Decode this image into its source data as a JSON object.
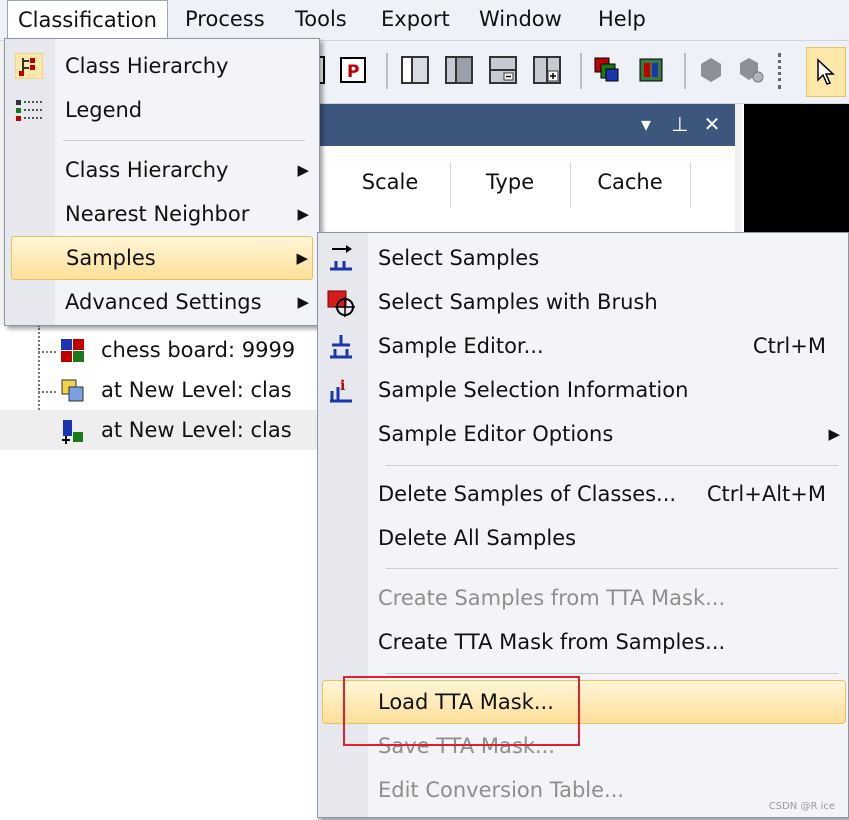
{
  "menubar": {
    "items": [
      "Classification",
      "Process",
      "Tools",
      "Export",
      "Window",
      "Help"
    ],
    "active": "Classification"
  },
  "panel": {
    "columns": [
      "Scale",
      "Type",
      "Cache"
    ]
  },
  "tree": {
    "rows": [
      {
        "text": "chess board: 9999"
      },
      {
        "text": "at  New Level: clas"
      },
      {
        "text": "at  New Level: clas"
      }
    ]
  },
  "classification_menu": {
    "items": [
      {
        "label": "Class Hierarchy",
        "icon": "class-hierarchy-icon",
        "submenu": false
      },
      {
        "label": "Legend",
        "icon": "legend-icon",
        "submenu": false
      },
      {
        "label": "Class Hierarchy",
        "submenu": true
      },
      {
        "label": "Nearest Neighbor",
        "submenu": true
      },
      {
        "label": "Samples",
        "submenu": true,
        "highlighted": true
      },
      {
        "label": "Advanced Settings",
        "submenu": true
      }
    ]
  },
  "samples_menu": {
    "items": [
      {
        "label": "Select Samples",
        "icon": "select-samples-icon"
      },
      {
        "label": "Select Samples with Brush",
        "icon": "brush-icon"
      },
      {
        "label": "Sample Editor...",
        "icon": "sample-editor-icon",
        "shortcut": "Ctrl+M"
      },
      {
        "label": "Sample Selection Information",
        "icon": "sample-info-icon"
      },
      {
        "label": "Sample Editor Options",
        "submenu": true
      },
      {
        "label": "Delete Samples of Classes...",
        "shortcut": "Ctrl+Alt+M"
      },
      {
        "label": "Delete All Samples"
      },
      {
        "label": "Create Samples from TTA Mask...",
        "disabled": true
      },
      {
        "label": "Create TTA Mask from Samples..."
      },
      {
        "label": "Load TTA Mask...",
        "highlighted": true
      },
      {
        "label": "Save TTA Mask...",
        "disabled": true
      },
      {
        "label": "Edit Conversion Table...",
        "disabled": true
      }
    ]
  },
  "watermark": "CSDN @R ice",
  "colors": {
    "highlight": "#fddf99",
    "panel_header": "#3c567e",
    "annotation_box": "#e0202a"
  }
}
